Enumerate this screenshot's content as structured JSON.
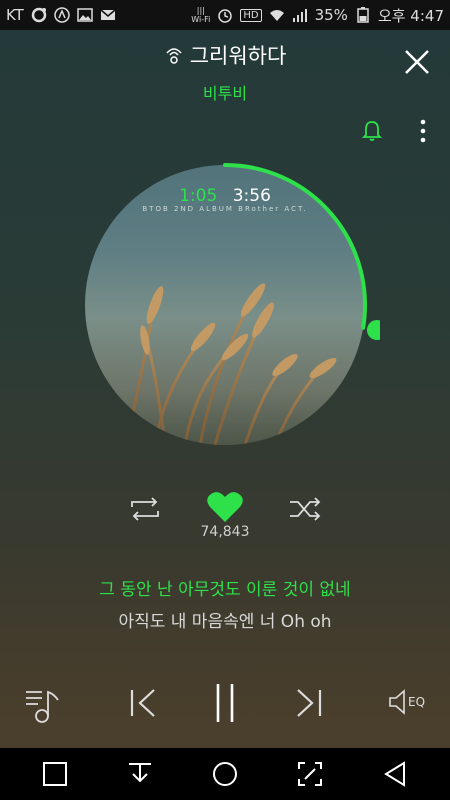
{
  "status_bar": {
    "carrier": "KT",
    "battery": "35%",
    "time": "오후 4:47",
    "wifi_label": "Wi-Fi",
    "hd_label": "HD"
  },
  "header": {
    "title": "그리워하다",
    "artist": "비투비"
  },
  "album": {
    "cover_text": "BTOB 2ND ALBUM  BRother ACT.",
    "elapsed": "1:05",
    "duration": "3:56",
    "progress_fraction": 0.276
  },
  "actions": {
    "like_count": "74,843"
  },
  "lyrics": {
    "current": "그 동안 난 아무것도 이룬 것이 없네",
    "next": "아직도 내 마음속엔 너 Oh oh"
  },
  "player": {
    "eq_label": "EQ"
  },
  "colors": {
    "accent": "#2ee04a"
  }
}
